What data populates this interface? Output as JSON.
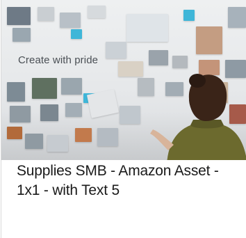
{
  "hero": {
    "caption": "Create with pride",
    "image_icon": "hero-photo-icon"
  },
  "card": {
    "title": "Supplies SMB - Amazon Asset - 1x1 - with Text 5"
  },
  "colors": {
    "wall": "#e6e8ea",
    "accent_blue": "#3fb6d8",
    "hair": "#2a1a12",
    "shirt": "#6c6a2e",
    "title_text": "#1a1a1a"
  }
}
